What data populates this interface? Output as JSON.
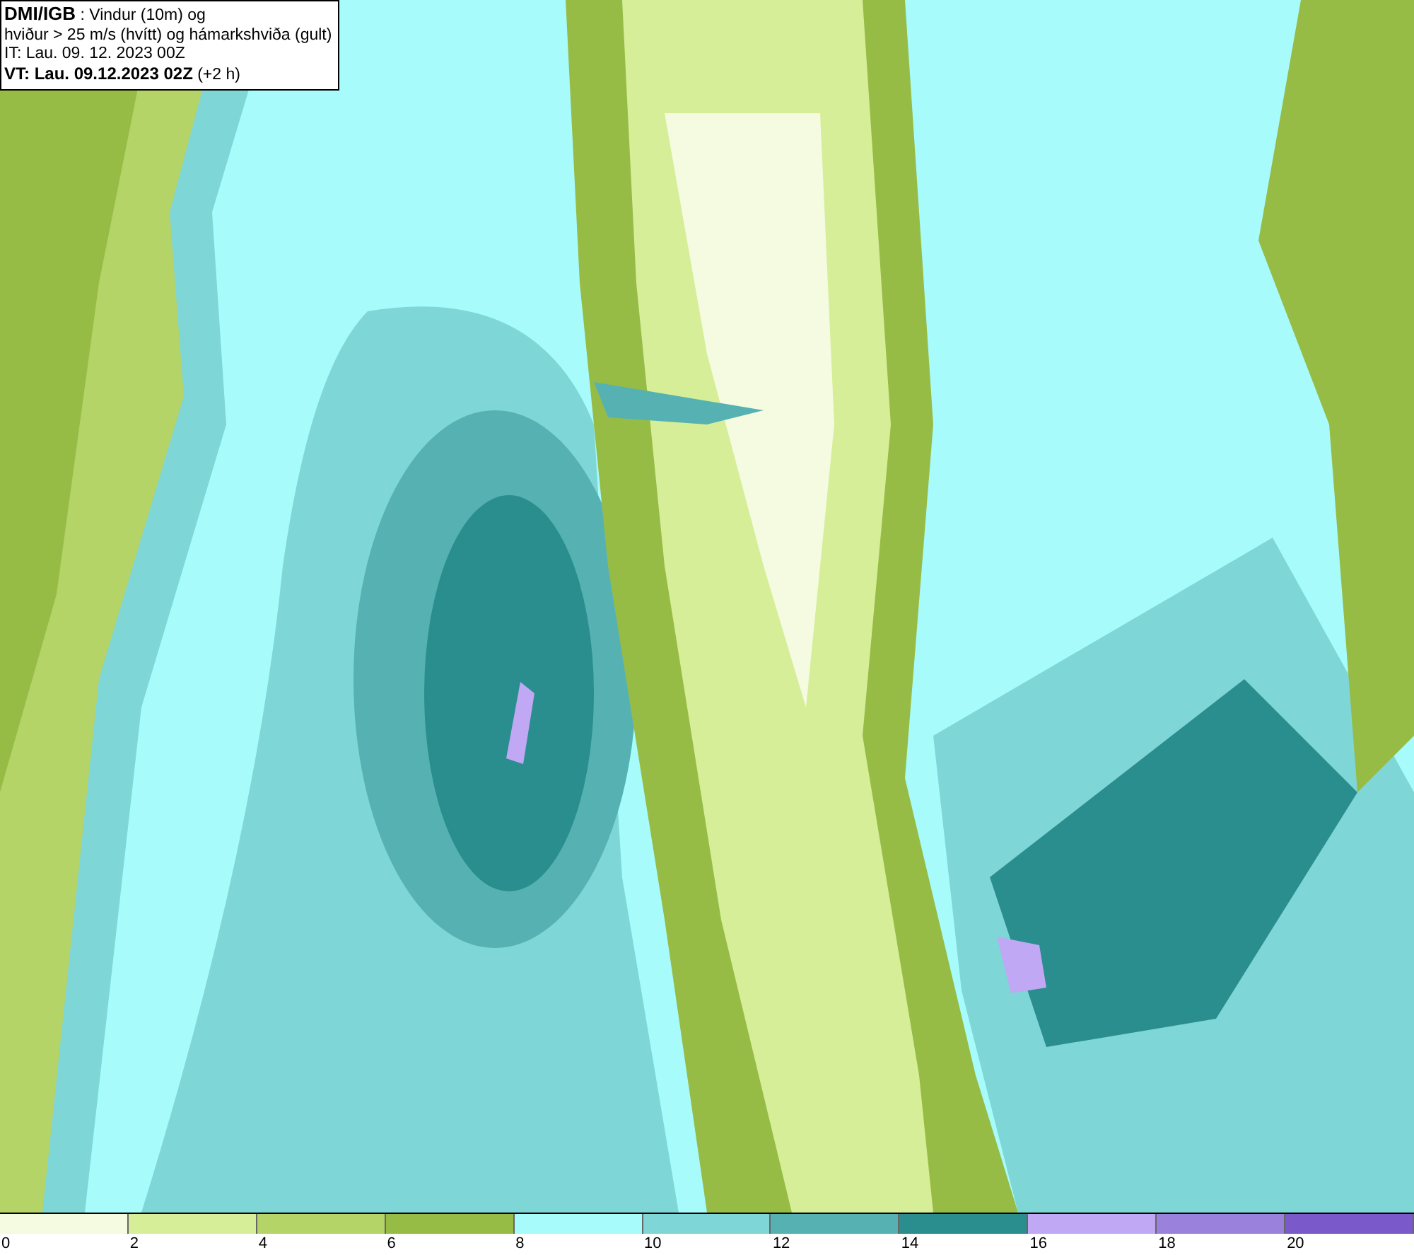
{
  "header": {
    "source": "DMI/IGB",
    "title": ": Vindur (10m) og",
    "subtitle": "hviður > 25 m/s (hvítt) og hámarkshviða (gult)",
    "initial_time": "IT: Lau. 09. 12. 2023 00Z",
    "valid_time": "VT: Lau. 09.12.2023 02Z",
    "offset": "(+2 h)"
  },
  "legend": {
    "bins": [
      {
        "color": "#f4fbe0"
      },
      {
        "color": "#d6ee98"
      },
      {
        "color": "#b4d468"
      },
      {
        "color": "#97bc46"
      },
      {
        "color": "#a8fbfb"
      },
      {
        "color": "#7fd6d6"
      },
      {
        "color": "#56b2b2"
      },
      {
        "color": "#2a8e8e"
      },
      {
        "color": "#c0a8f4"
      },
      {
        "color": "#9a82dc"
      },
      {
        "color": "#7a5aca"
      }
    ],
    "ticks": [
      "0",
      "2",
      "4",
      "6",
      "8",
      "10",
      "12",
      "14",
      "16",
      "18",
      "20"
    ]
  }
}
